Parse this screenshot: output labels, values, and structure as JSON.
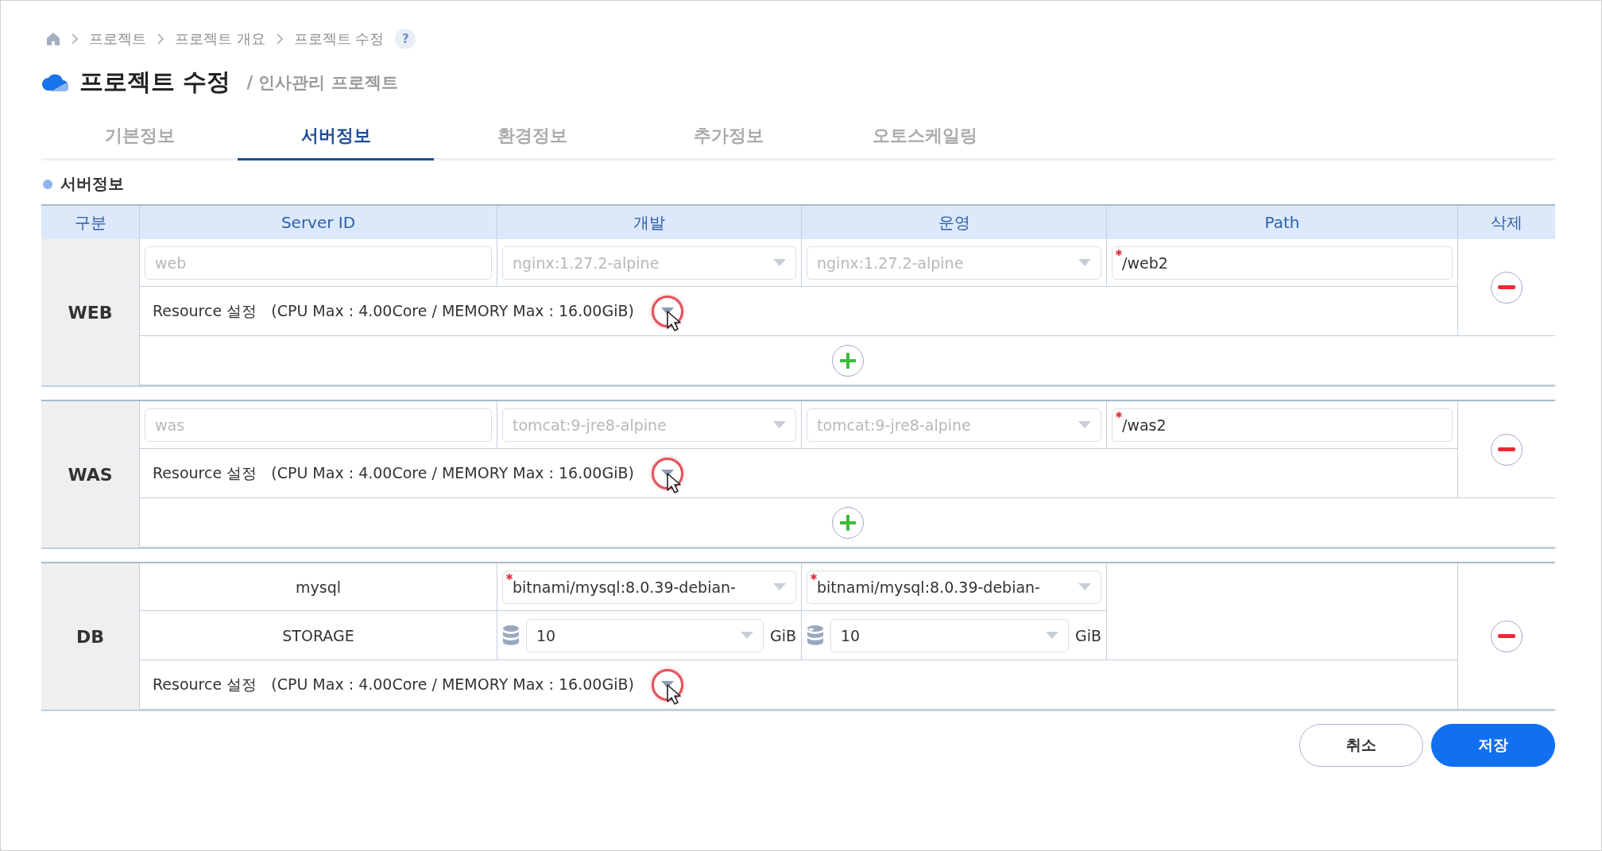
{
  "breadcrumb": [
    "프로젝트",
    "프로젝트 개요",
    "프로젝트 수정"
  ],
  "help_badge": "?",
  "title": "프로젝트 수정",
  "subtitle": "/ 인사관리 프로젝트",
  "tabs": [
    {
      "label": "기본정보",
      "selected": false
    },
    {
      "label": "서버정보",
      "selected": true
    },
    {
      "label": "환경정보",
      "selected": false
    },
    {
      "label": "추가정보",
      "selected": false
    },
    {
      "label": "오토스케일링",
      "selected": false
    }
  ],
  "section_title": "서버정보",
  "table": {
    "columns": [
      "구분",
      "Server ID",
      "개발",
      "운영",
      "Path",
      "삭제"
    ],
    "groups": [
      {
        "kind": "server",
        "label": "WEB",
        "server_id": "web",
        "dev_image": "nginx:1.27.2-alpine",
        "prod_image": "nginx:1.27.2-alpine",
        "disabled": true,
        "path": "/web2",
        "path_required": true,
        "resource_label": "Resource 설정",
        "resource_detail": "(CPU Max : 4.00Core / MEMORY Max : 16.00GiB)",
        "highlighted": true
      },
      {
        "kind": "server",
        "label": "WAS",
        "server_id": "was",
        "dev_image": "tomcat:9-jre8-alpine",
        "prod_image": "tomcat:9-jre8-alpine",
        "disabled": true,
        "path": "/was2",
        "path_required": true,
        "resource_label": "Resource 설정",
        "resource_detail": "(CPU Max : 4.00Core / MEMORY Max : 16.00GiB)",
        "highlighted": true
      },
      {
        "kind": "db",
        "label": "DB",
        "name": "mysql",
        "dev_image": "bitnami/mysql:8.0.39-debian-",
        "prod_image": "bitnami/mysql:8.0.39-debian-",
        "image_required": true,
        "storage_label": "STORAGE",
        "dev_storage": "10",
        "dev_unit": "GiB",
        "prod_storage": "10",
        "prod_unit": "GiB",
        "resource_label": "Resource 설정",
        "resource_detail": "(CPU Max : 4.00Core / MEMORY Max : 16.00GiB)",
        "highlighted": true
      }
    ]
  },
  "buttons": [
    {
      "kind": "cancel",
      "label": "취소"
    },
    {
      "kind": "save",
      "label": "저장"
    }
  ]
}
